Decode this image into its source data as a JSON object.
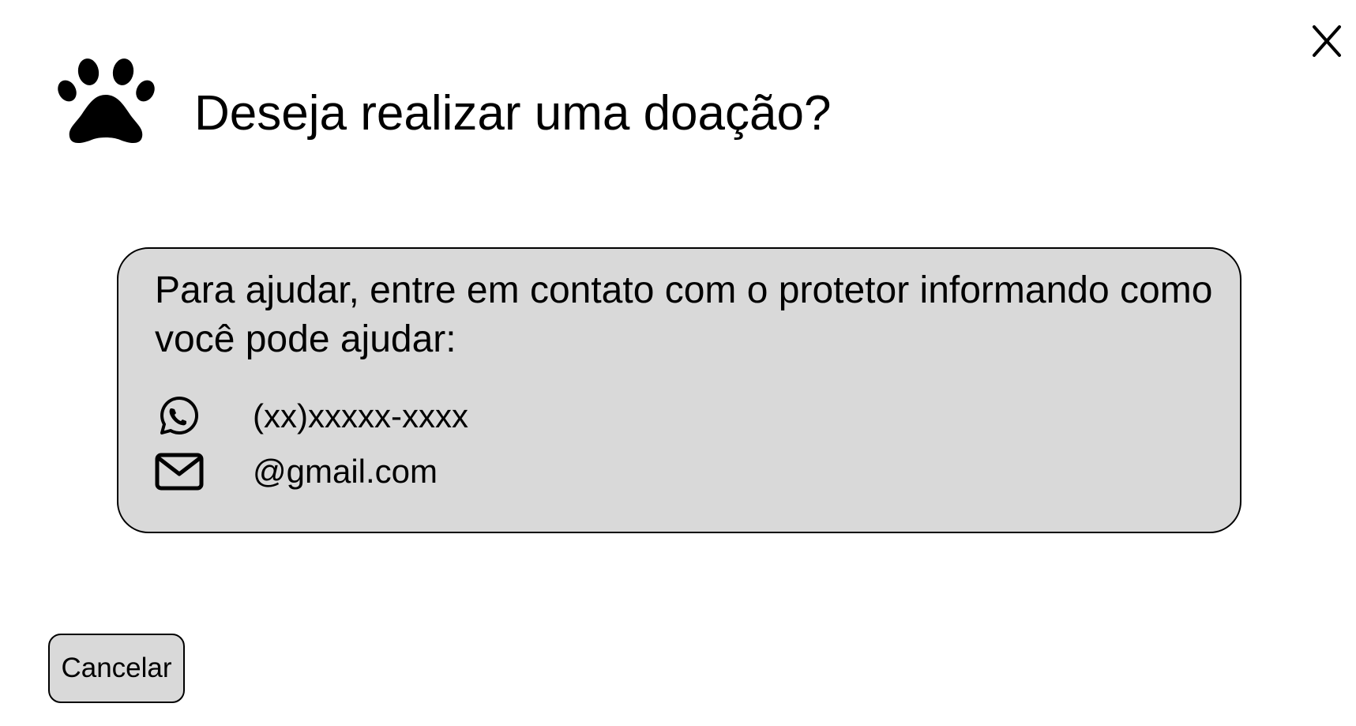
{
  "dialog": {
    "title": "Deseja realizar uma doação?",
    "icons": {
      "logo": "paw-icon",
      "close": "close-icon"
    }
  },
  "card": {
    "message": "Para ajudar, entre em contato com o protetor informando como você pode ajudar:",
    "background": "#d9d9d9",
    "contacts": [
      {
        "icon": "whatsapp-icon",
        "value": "(xx)xxxxx-xxxx"
      },
      {
        "icon": "mail-icon",
        "value": "@gmail.com"
      }
    ]
  },
  "actions": {
    "cancel_label": "Cancelar"
  }
}
